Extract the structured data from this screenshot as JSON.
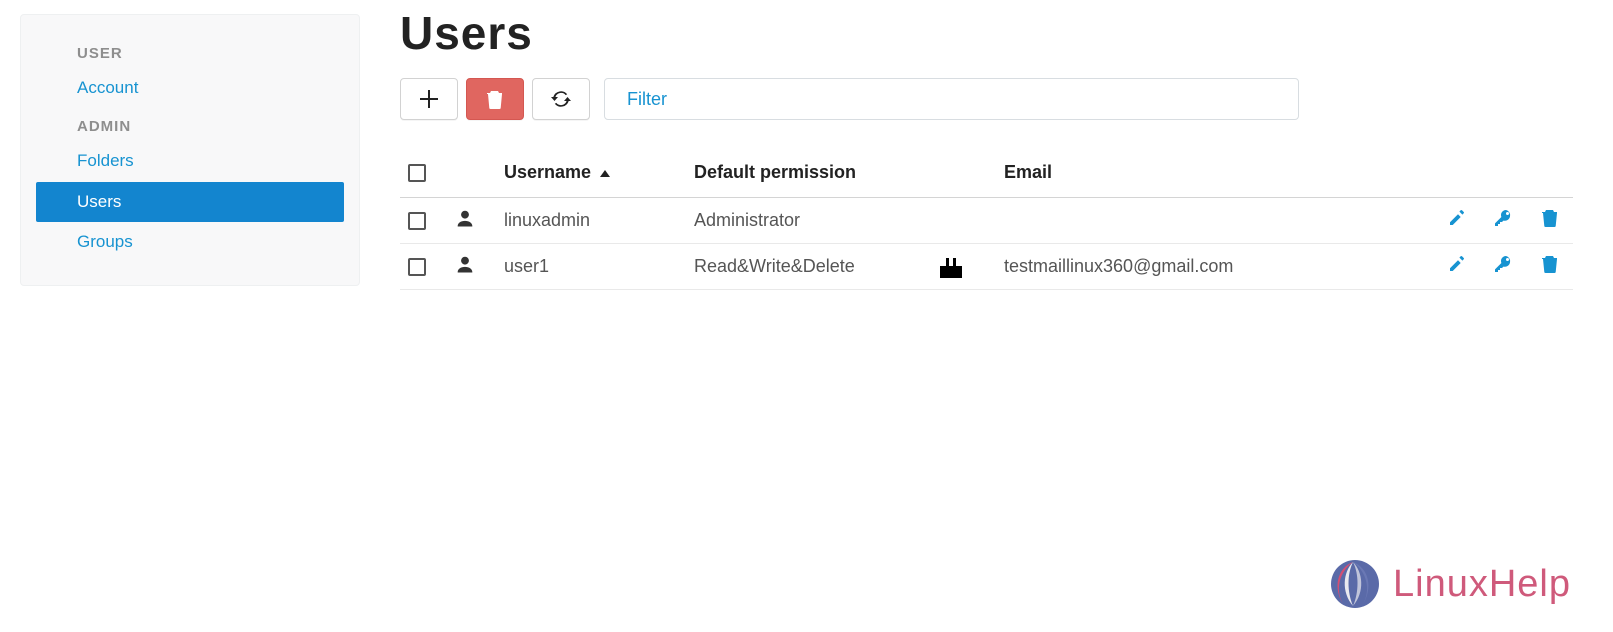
{
  "sidebar": {
    "sections": [
      {
        "header": "USER",
        "items": [
          {
            "label": "Account",
            "selected": false
          }
        ]
      },
      {
        "header": "ADMIN",
        "items": [
          {
            "label": "Folders",
            "selected": false
          },
          {
            "label": "Users",
            "selected": true
          },
          {
            "label": "Groups",
            "selected": false
          }
        ]
      }
    ]
  },
  "page": {
    "title": "Users"
  },
  "toolbar": {
    "filter_placeholder": "Filter"
  },
  "table": {
    "columns": {
      "username": "Username",
      "permission": "Default permission",
      "email": "Email"
    },
    "rows": [
      {
        "username": "linuxadmin",
        "permission": "Administrator",
        "email": ""
      },
      {
        "username": "user1",
        "permission": "Read&Write&Delete",
        "email": "testmaillinux360@gmail.com"
      }
    ]
  },
  "branding": {
    "logo_text": "LinuxHelp"
  }
}
